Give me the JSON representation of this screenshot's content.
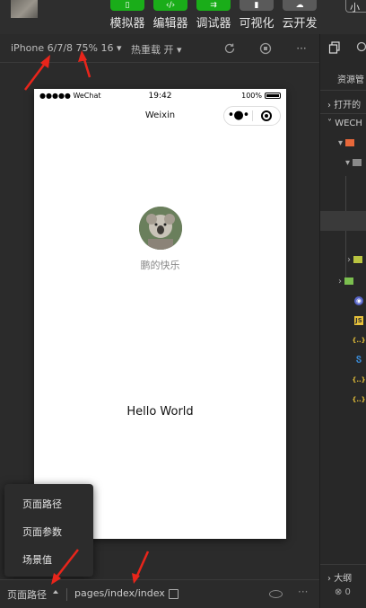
{
  "toolbar": {
    "tools": [
      {
        "label": "模拟器",
        "icon": "phone-icon",
        "glyph": "▯",
        "color": "green"
      },
      {
        "label": "编辑器",
        "icon": "code-icon",
        "glyph": "‹/›",
        "color": "green"
      },
      {
        "label": "调试器",
        "icon": "debug-icon",
        "glyph": "⇉",
        "color": "green"
      },
      {
        "label": "可视化",
        "icon": "visual-icon",
        "glyph": "▮",
        "color": "gray"
      },
      {
        "label": "云开发",
        "icon": "cloud-icon",
        "glyph": "☁",
        "color": "gray"
      }
    ],
    "right_btn": "小"
  },
  "simulator_bar": {
    "device": "iPhone 6/7/8 75% 16 ▾",
    "hot_reload": "热重载 开 ▾"
  },
  "phone": {
    "carrier": "●●●●● WeChat",
    "time": "19:42",
    "battery": "100%",
    "nav_title": "Weixin",
    "capsule_more": "•●•",
    "nickname": "鹏的快乐",
    "hello": "Hello World"
  },
  "popup_menu": {
    "items": [
      "页面路径",
      "页面参数",
      "场景值"
    ]
  },
  "bottom_bar": {
    "path_label": "页面路径",
    "path": "pages/index/index"
  },
  "right_panel": {
    "header": "资源管",
    "open_section": "打开的",
    "project_section": "WECH",
    "outline_section": "大纲",
    "status": "⊗ 0"
  },
  "colors": {
    "accent_green": "#1aad19",
    "annotation_red": "#e8251b"
  }
}
